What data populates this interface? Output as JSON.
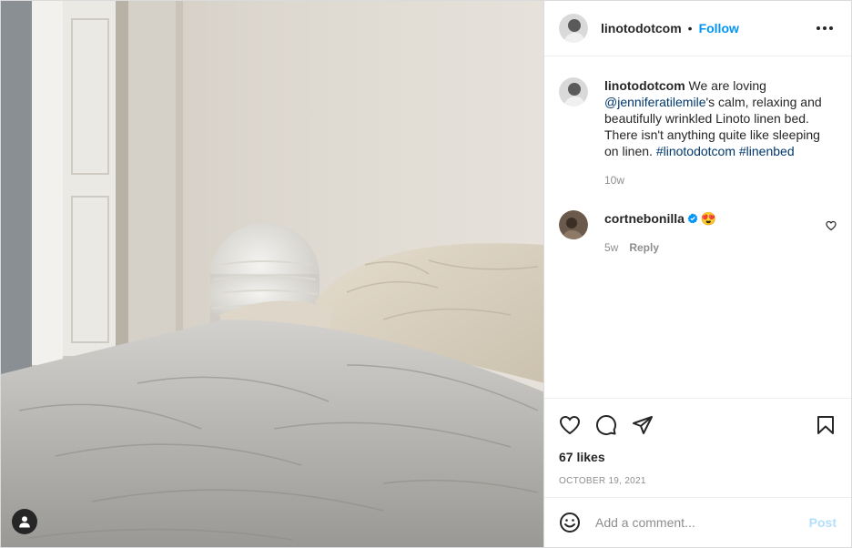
{
  "post": {
    "author": "linotodotcom",
    "dot": "•",
    "follow_label": "Follow",
    "caption": {
      "username": "linotodotcom",
      "text_1": " We are loving ",
      "mention": "@jenniferatilemile",
      "text_2": "'s calm, relaxing and beautifully wrinkled Linoto linen bed. There isn't anything quite like sleeping on linen. ",
      "hashtag_1": "#linotodotcom",
      "space": " ",
      "hashtag_2": "#linenbed",
      "time": "10w"
    },
    "comments": [
      {
        "username": "cortnebonilla",
        "text": "😍",
        "time": "5w",
        "reply_label": "Reply"
      }
    ],
    "likes": "67 likes",
    "date": "October 19, 2021",
    "add_comment": {
      "placeholder": "Add a comment...",
      "post_label": "Post"
    }
  },
  "colors": {
    "accent": "#0095f6",
    "link": "#00376b",
    "muted": "#8e8e8e",
    "post_disabled": "#b2dffc"
  },
  "icons": [
    "user-tag-icon",
    "more-options-icon",
    "heart-icon",
    "comment-icon",
    "share-icon",
    "bookmark-icon",
    "emoji-icon",
    "verified-badge-icon"
  ]
}
